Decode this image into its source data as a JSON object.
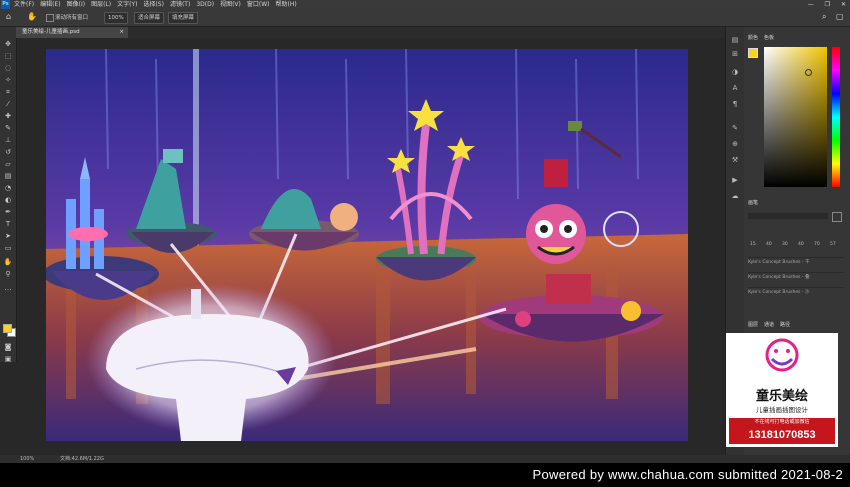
{
  "menubar": {
    "logo": "Ps",
    "items": [
      "文件(F)",
      "编辑(E)",
      "图像(I)",
      "图层(L)",
      "文字(Y)",
      "选择(S)",
      "滤镜(T)",
      "3D(D)",
      "视图(V)",
      "窗口(W)",
      "帮助(H)"
    ],
    "window_controls": [
      "—",
      "❐",
      "✕"
    ]
  },
  "options_bar": {
    "tool_label": "✋",
    "check_label": "滚动所有窗口",
    "zoom_btn": "100%",
    "fit_btn": "适合屏幕",
    "fill_btn": "填充屏幕"
  },
  "document_tab": {
    "title": "童乐美绘-儿童插画.psd",
    "close": "×"
  },
  "panels": {
    "color_tab": "颜色",
    "swatch_tab": "色板",
    "brush_tab": "画笔",
    "brush_sizes": [
      "15",
      "40",
      "30",
      "40",
      "70",
      "57"
    ],
    "brush_names": [
      "Kyle's Concept Brushes - 干",
      "Kyle's Concept Brushes - 叠",
      "Kyle's Concept Brushes - 沙"
    ],
    "layers_tab": "图层",
    "channels_tab": "通道",
    "paths_tab": "路径"
  },
  "ad": {
    "brand": "童乐美绘",
    "subtitle": "儿童插画插图设计",
    "note": "不在线可打电话或加微信",
    "phone": "13181070853"
  },
  "statusbar": {
    "zoom": "100%",
    "doc_info": "文档:42.6M/1.22G"
  },
  "footer": {
    "text": "Powered  by  www.chahua.com  submitted  2021-08-2"
  },
  "colors": {
    "accent_red": "#c4161c",
    "foreground": "#ffd11a",
    "sky": "#3a2a9a"
  }
}
